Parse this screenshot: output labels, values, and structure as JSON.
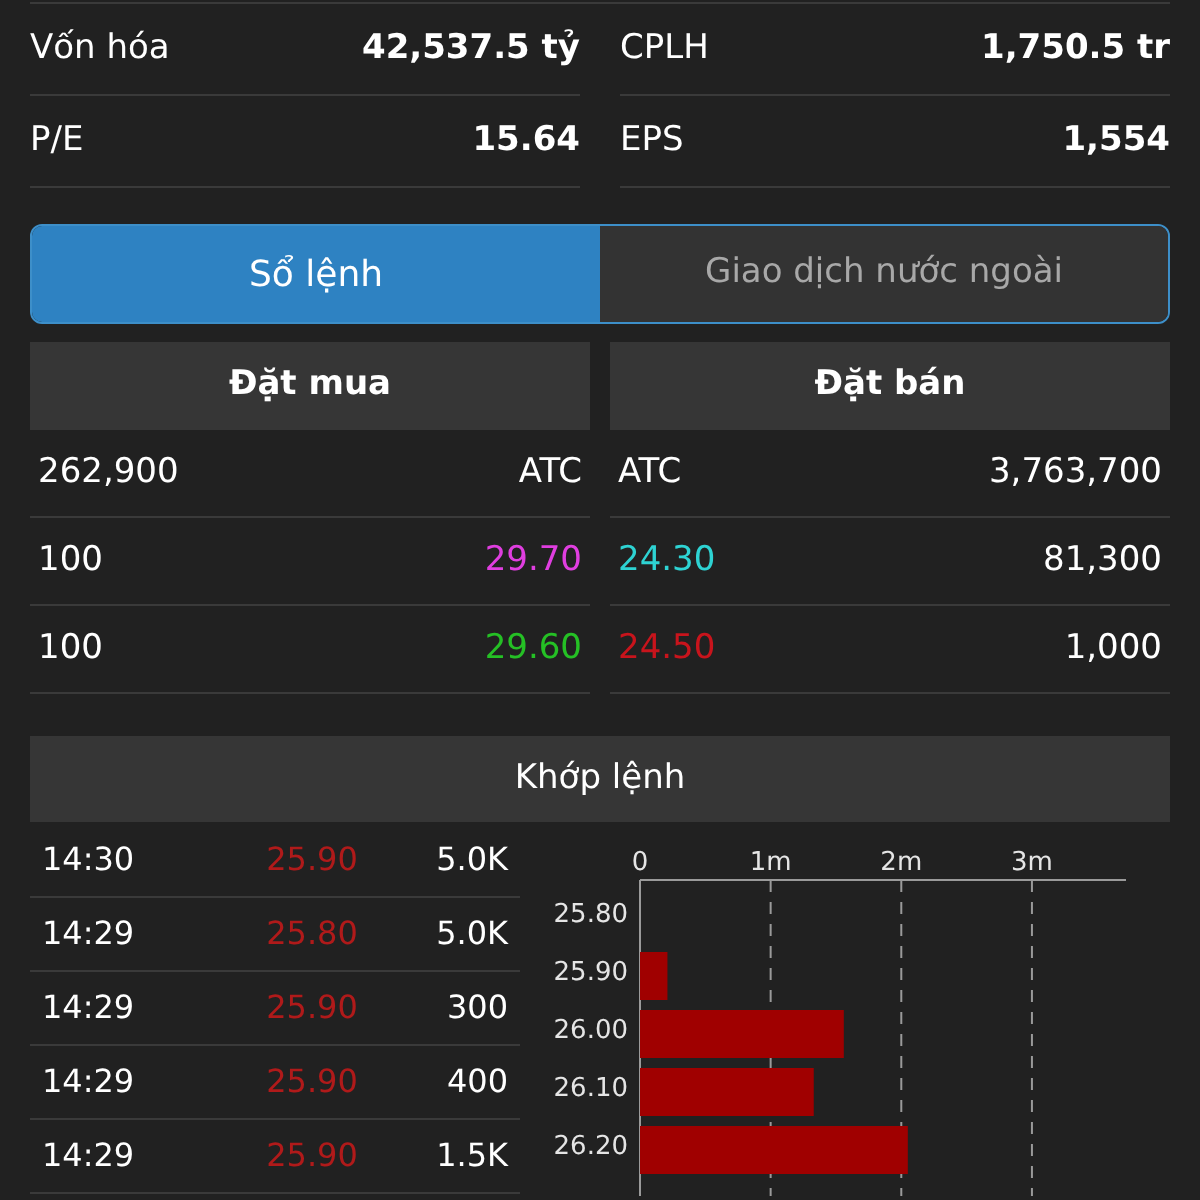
{
  "stats": [
    {
      "label": "Vốn hóa",
      "value": "42,537.5 tỷ"
    },
    {
      "label": "CPLH",
      "value": "1,750.5 tr"
    },
    {
      "label": "P/E",
      "value": "15.64"
    },
    {
      "label": "EPS",
      "value": "1,554"
    }
  ],
  "tabs": [
    {
      "label": "Sổ lệnh",
      "selected": true
    },
    {
      "label": "Giao dịch nước ngoài",
      "selected": false
    }
  ],
  "order_book": {
    "buy_header": "Đặt mua",
    "sell_header": "Đặt bán",
    "rows": [
      {
        "buy": {
          "volume": "262,900",
          "price": "ATC",
          "color": "#ffffff"
        },
        "sell": {
          "price": "ATC",
          "color": "#ffffff",
          "volume": "3,763,700"
        }
      },
      {
        "buy": {
          "volume": "100",
          "price": "29.70",
          "color": "#e03ee0"
        },
        "sell": {
          "price": "24.30",
          "color": "#2ed3d3",
          "volume": "81,300"
        }
      },
      {
        "buy": {
          "volume": "100",
          "price": "29.60",
          "color": "#25c025"
        },
        "sell": {
          "price": "24.50",
          "color": "#c8141c",
          "volume": "1,000"
        }
      }
    ]
  },
  "matched": {
    "title": "Khớp lệnh",
    "trades": [
      {
        "time": "14:30",
        "price": "25.90",
        "color": "#b01a1a",
        "volume": "5.0K"
      },
      {
        "time": "14:29",
        "price": "25.80",
        "color": "#b01a1a",
        "volume": "5.0K"
      },
      {
        "time": "14:29",
        "price": "25.90",
        "color": "#b01a1a",
        "volume": "300"
      },
      {
        "time": "14:29",
        "price": "25.90",
        "color": "#b01a1a",
        "volume": "400"
      },
      {
        "time": "14:29",
        "price": "25.90",
        "color": "#b01a1a",
        "volume": "1.5K"
      }
    ],
    "chart_data": {
      "type": "bar",
      "orientation": "horizontal",
      "grid": true,
      "categories": [
        "25.80",
        "25.90",
        "26.00",
        "26.10",
        "26.20"
      ],
      "values": [
        0,
        0.21,
        1.56,
        1.33,
        2.05
      ],
      "xlim": [
        0,
        3.72
      ],
      "xticks": [
        {
          "value": 0,
          "label": "0"
        },
        {
          "value": 1,
          "label": "1m"
        },
        {
          "value": 2,
          "label": "2m"
        },
        {
          "value": 3,
          "label": "3m"
        }
      ]
    }
  }
}
